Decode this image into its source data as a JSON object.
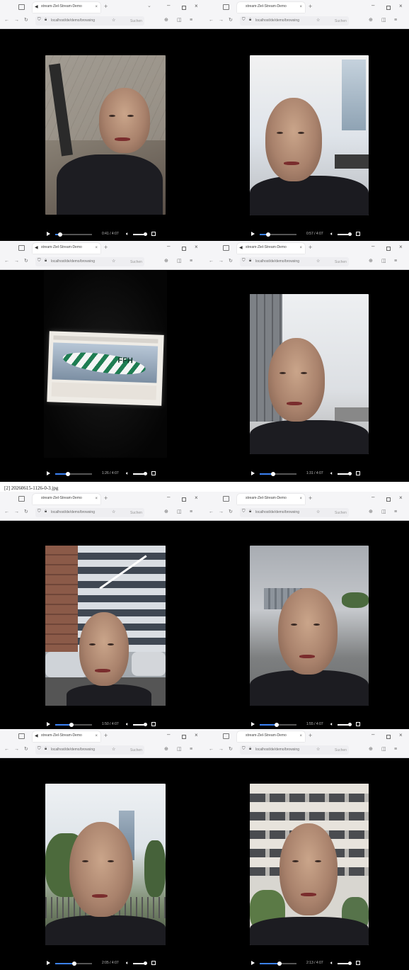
{
  "caption": "[2] 20260615-1126-0-3.jpg",
  "panels": [
    {
      "tab_title": "stream-Ziel-Stream-Demo",
      "url_text": "localhost/de/demo/browsing",
      "search_placeholder": "Suchen",
      "time": "0:41 / 4:07",
      "progress": 0.13
    },
    {
      "tab_title": "stream-Ziel-Stream-Demo",
      "url_text": "localhost/de/demo/browsing",
      "search_placeholder": "Suchen",
      "time": "0:57 / 4:07",
      "progress": 0.23
    },
    {
      "tab_title": "stream-Ziel-Stream-Demo",
      "url_text": "localhost/de/demo/browsing",
      "search_placeholder": "Suchen",
      "time": "1:26 / 4:07",
      "progress": 0.35
    },
    {
      "tab_title": "stream-Ziel-Stream-Demo",
      "url_text": "localhost/de/demo/browsing",
      "search_placeholder": "Suchen",
      "time": "1:31 / 4:07",
      "progress": 0.37
    },
    {
      "tab_title": "stream-Ziel-Stream-Demo",
      "url_text": "localhost/de/demo/browsing",
      "search_placeholder": "Suchen",
      "time": "1:50 / 4:07",
      "progress": 0.45
    },
    {
      "tab_title": "stream-Ziel-Stream-Demo",
      "url_text": "localhost/de/demo/browsing",
      "search_placeholder": "Suchen",
      "time": "1:55 / 4:07",
      "progress": 0.47
    },
    {
      "tab_title": "stream-Ziel-Stream-Demo",
      "url_text": "localhost/de/demo/browsing",
      "search_placeholder": "Suchen",
      "time": "2:05 / 4:07",
      "progress": 0.51
    },
    {
      "tab_title": "stream-Ziel-Stream-Demo",
      "url_text": "localhost/de/demo/browsing",
      "search_placeholder": "Suchen",
      "time": "2:13 / 4:07",
      "progress": 0.54
    }
  ],
  "video3_banner": "FFH",
  "colors": {
    "accent": "#3b82f6",
    "background": "#000000"
  }
}
